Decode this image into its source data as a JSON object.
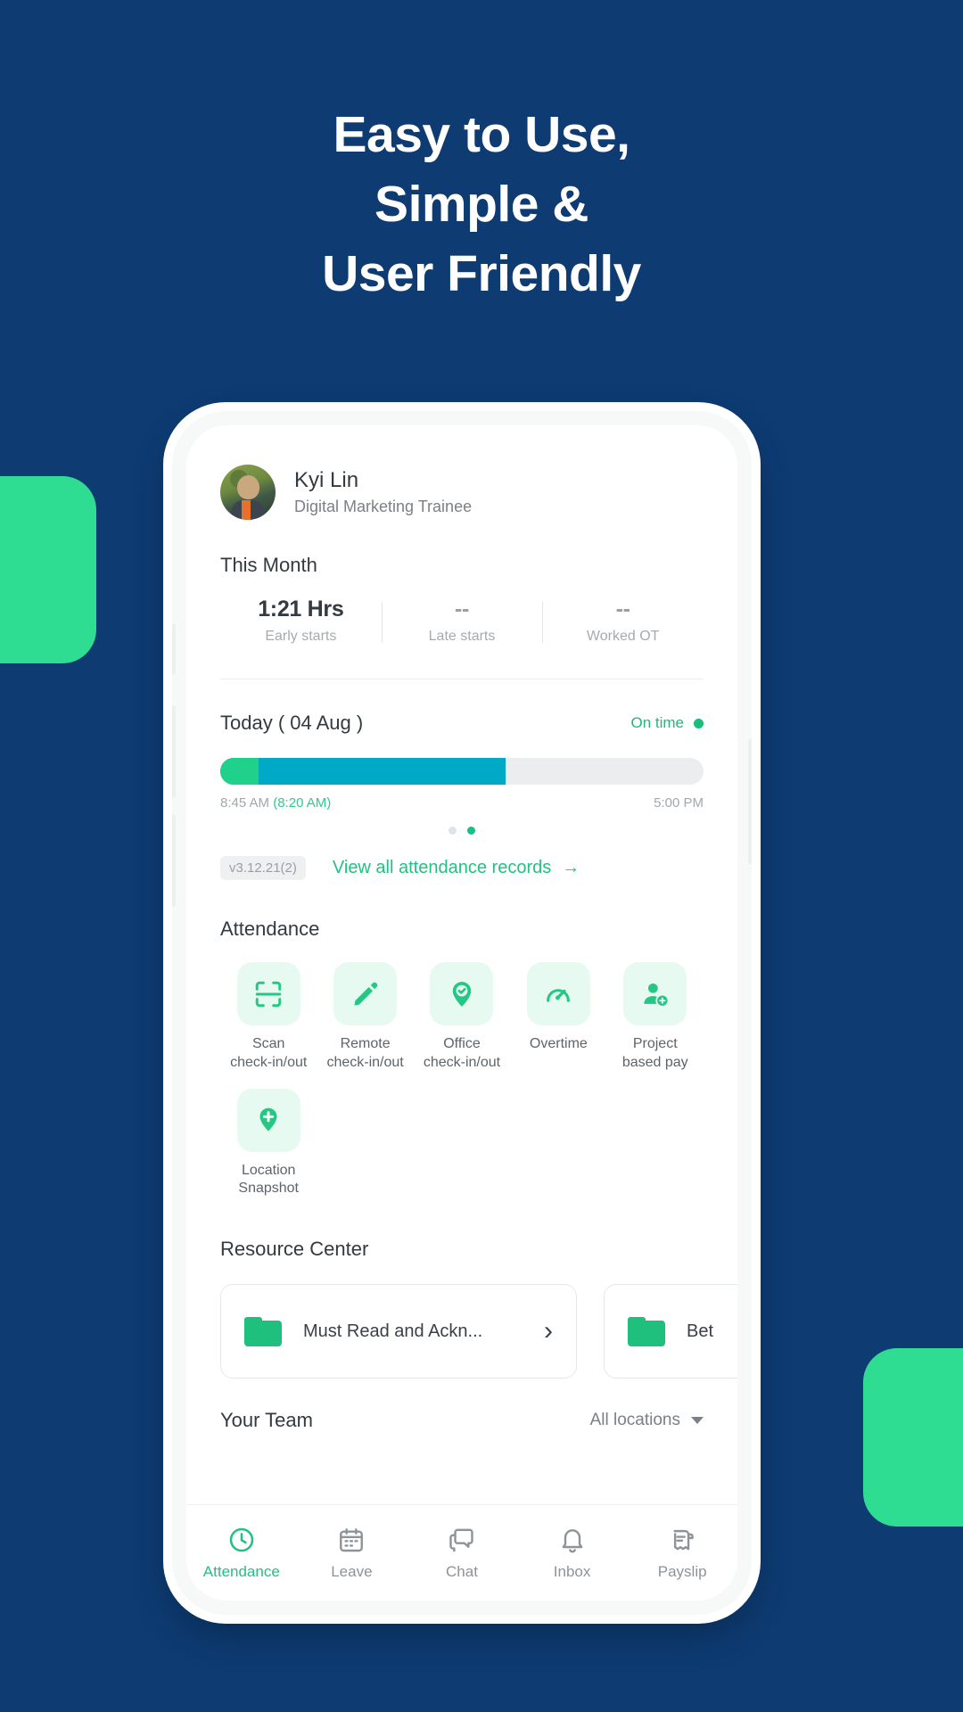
{
  "promo": {
    "headline_lines": [
      "Easy to Use,",
      "Simple &",
      "User Friendly"
    ],
    "background_color": "#0d3b72",
    "accent_color": "#2fdd92"
  },
  "app": {
    "profile": {
      "name": "Kyi Lin",
      "role": "Digital Marketing Trainee",
      "avatar_name": "user-avatar"
    },
    "this_month": {
      "title": "This Month",
      "stats": [
        {
          "value": "1:21 Hrs",
          "label": "Early starts"
        },
        {
          "value": "--",
          "label": "Late starts"
        },
        {
          "value": "--",
          "label": "Worked OT"
        }
      ]
    },
    "today": {
      "title": "Today ( 04 Aug )",
      "status": "On time",
      "status_color": "#14c07a",
      "start_time": "8:45 AM",
      "scheduled_time": "(8:20 AM)",
      "end_time": "5:00 PM",
      "progress_percent": 59,
      "early_segment_percent": 8,
      "carousel_dots": 2,
      "carousel_active_index": 1
    },
    "links": {
      "version": "v3.12.21(2)",
      "view_all": "View all attendance records",
      "view_all_arrow": "→"
    },
    "attendance": {
      "title": "Attendance",
      "items": [
        {
          "label": "Scan\ncheck-in/out",
          "line1": "Scan",
          "line2": "check-in/out",
          "icon": "scan-icon"
        },
        {
          "label": "Remote check-in/out",
          "line1": "Remote",
          "line2": "check-in/out",
          "icon": "pencil-icon"
        },
        {
          "label": "Office check-in/out",
          "line1": "Office",
          "line2": "check-in/out",
          "icon": "location-check-icon"
        },
        {
          "label": "Overtime",
          "line1": "Overtime",
          "line2": "",
          "icon": "gauge-icon"
        },
        {
          "label": "Project based pay",
          "line1": "Project",
          "line2": "based pay",
          "icon": "person-plus-icon"
        },
        {
          "label": "Location Snapshot",
          "line1": "Location",
          "line2": "Snapshot",
          "icon": "location-plus-icon"
        }
      ]
    },
    "resource_center": {
      "title": "Resource Center",
      "cards": [
        {
          "label": "Must Read and Ackn...",
          "icon": "folder-icon",
          "chevron": "›"
        },
        {
          "label": "Bet",
          "icon": "folder-icon",
          "chevron": ""
        }
      ]
    },
    "your_team": {
      "title": "Your Team",
      "filter": "All locations"
    },
    "bottom_nav": {
      "items": [
        {
          "label": "Attendance",
          "icon": "clock-icon",
          "active": true
        },
        {
          "label": "Leave",
          "icon": "calendar-icon",
          "active": false
        },
        {
          "label": "Chat",
          "icon": "chat-icon",
          "active": false
        },
        {
          "label": "Inbox",
          "icon": "bell-icon",
          "active": false
        },
        {
          "label": "Payslip",
          "icon": "payslip-icon",
          "active": false
        }
      ]
    }
  }
}
